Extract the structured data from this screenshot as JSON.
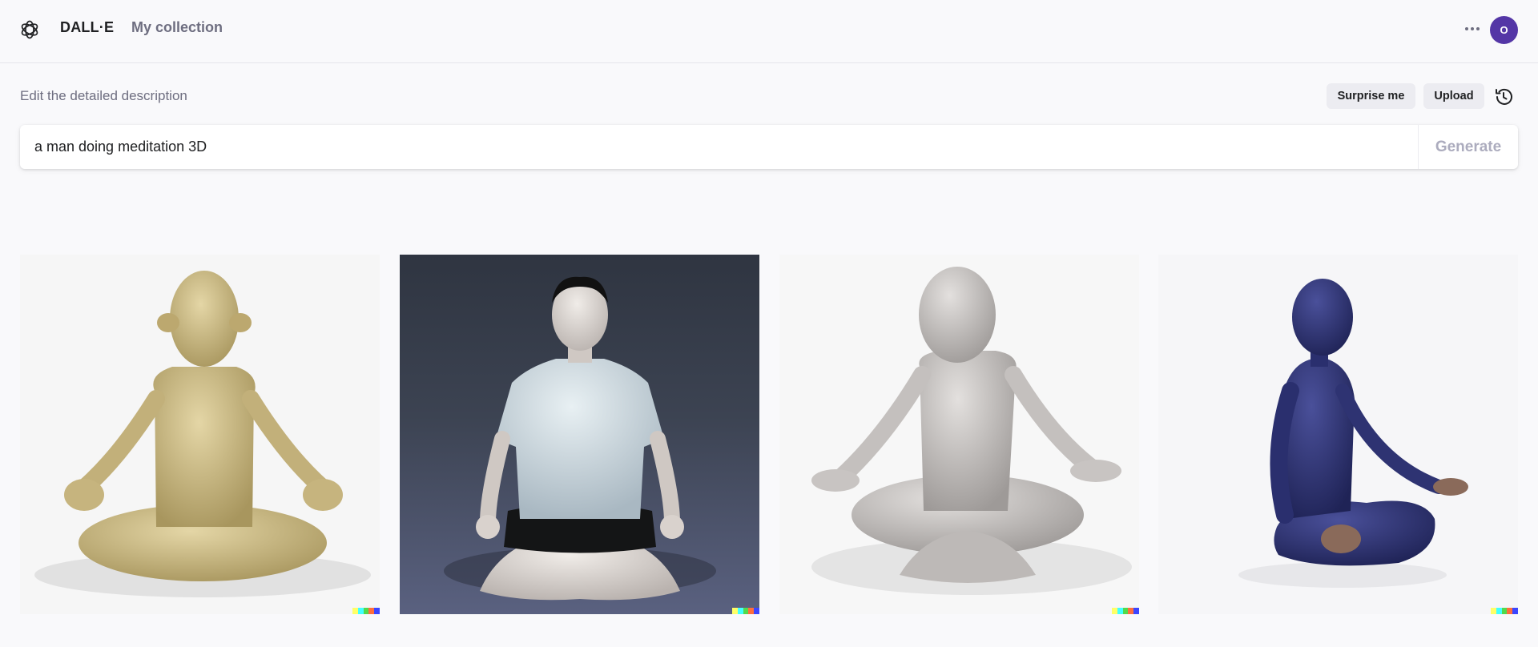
{
  "header": {
    "brand": "DALL·E",
    "nav_collection": "My collection",
    "avatar_initial": "O",
    "avatar_color": "#5436a6"
  },
  "prompt": {
    "label": "Edit the detailed description",
    "surprise_label": "Surprise me",
    "upload_label": "Upload",
    "value": "a man doing meditation 3D",
    "generate_label": "Generate"
  },
  "results": [
    {
      "alt": "beige figure meditating",
      "background": "#f6f6f6",
      "body_color": "#d2bf8a"
    },
    {
      "alt": "man in white t-shirt meditating",
      "background": "#2e3440",
      "body_color": "#dbe4ea"
    },
    {
      "alt": "grey figure meditating",
      "background": "#f7f7f7",
      "body_color": "#c9c5c3"
    },
    {
      "alt": "blue figure meditating",
      "background": "#f6f6f8",
      "body_color": "#2d3275"
    }
  ],
  "signature_colors": [
    "#ffff66",
    "#42ffff",
    "#51da4c",
    "#ff6e3c",
    "#3c46ff"
  ]
}
